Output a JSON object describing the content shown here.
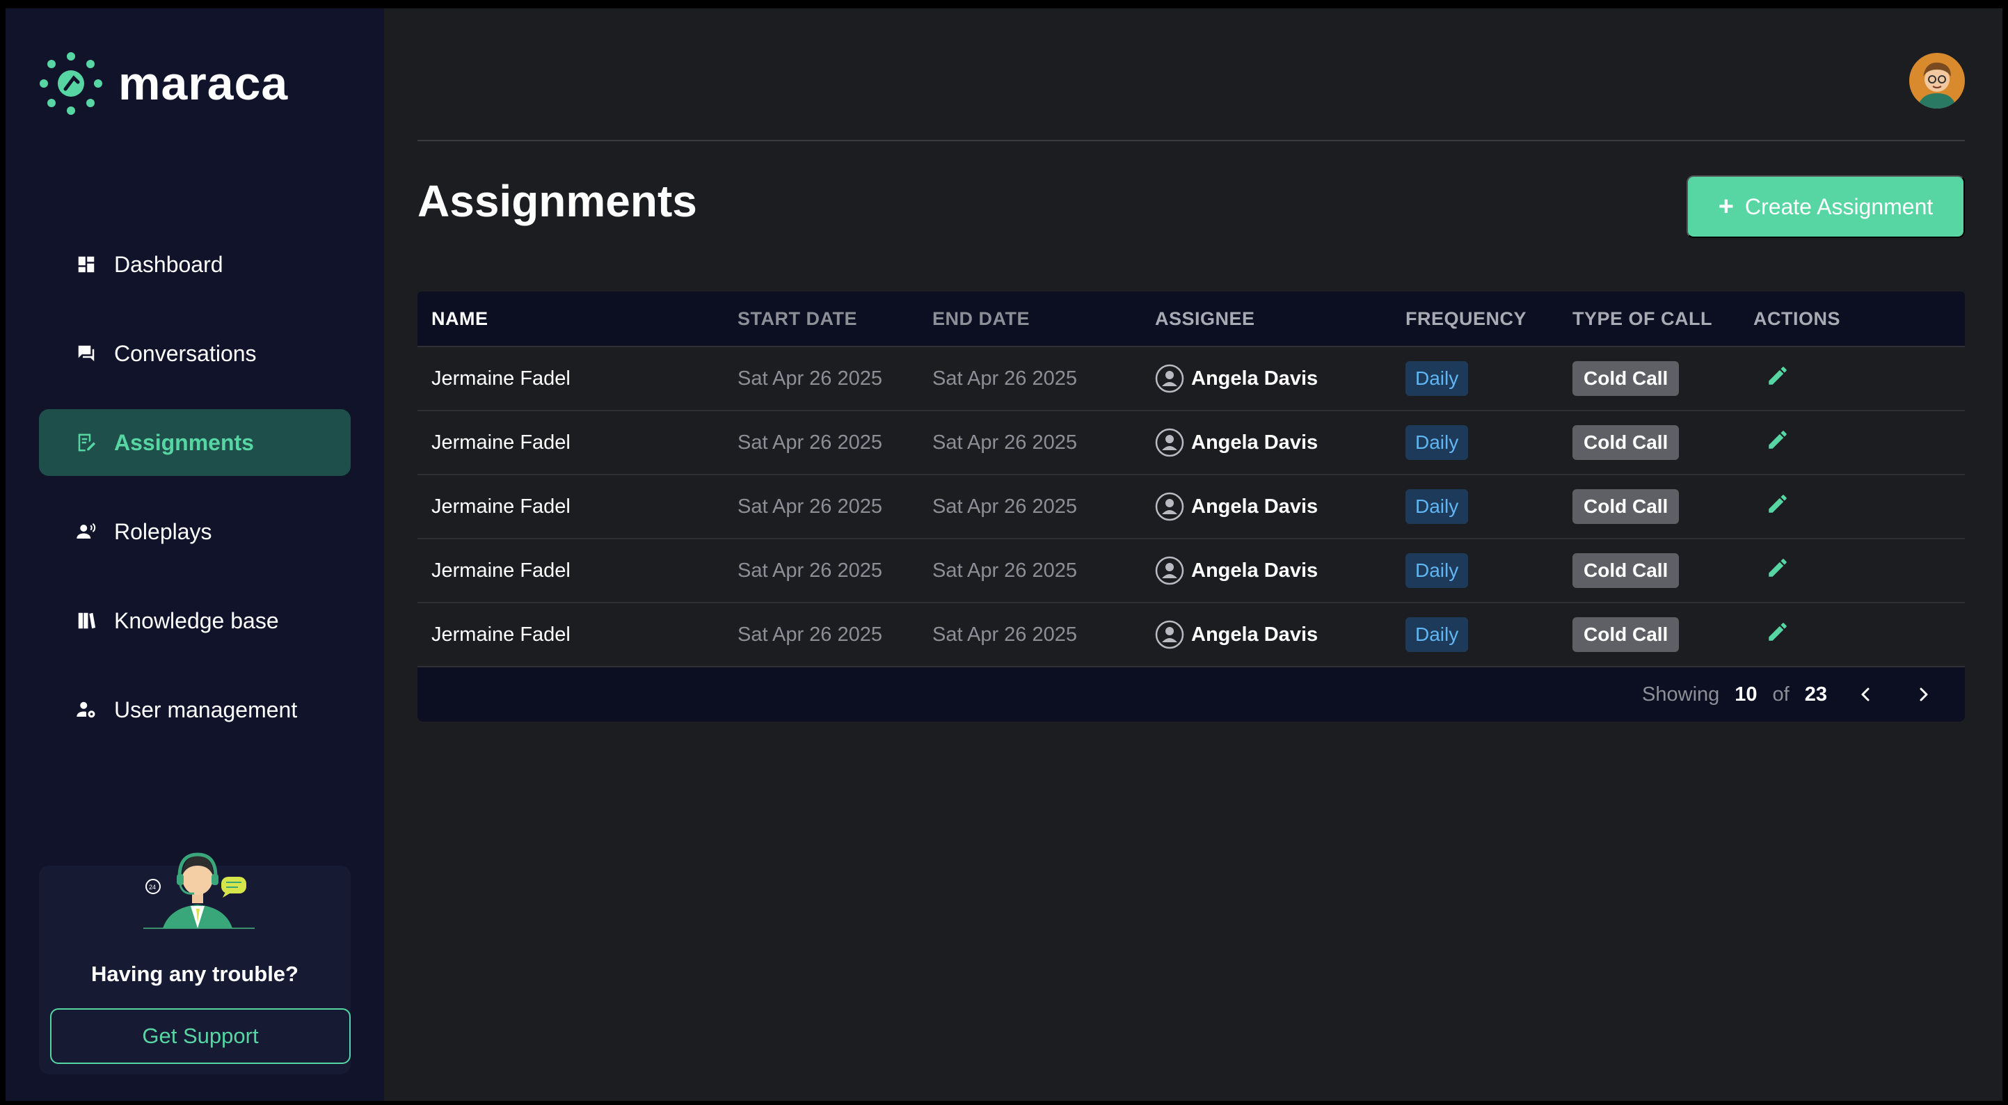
{
  "brand": {
    "name": "maraca",
    "accent": "#57d6a3"
  },
  "sidebar": {
    "items": [
      {
        "label": "Dashboard",
        "icon": "dashboard-icon",
        "active": false
      },
      {
        "label": "Conversations",
        "icon": "chat-icon",
        "active": false
      },
      {
        "label": "Assignments",
        "icon": "assignment-icon",
        "active": true
      },
      {
        "label": "Roleplays",
        "icon": "roleplay-icon",
        "active": false
      },
      {
        "label": "Knowledge base",
        "icon": "book-icon",
        "active": false
      },
      {
        "label": "User management",
        "icon": "user-settings-icon",
        "active": false
      }
    ],
    "support": {
      "title": "Having any trouble?",
      "button": "Get Support"
    }
  },
  "header": {
    "avatar": "user-avatar"
  },
  "main": {
    "title": "Assignments",
    "create_button": "Create Assignment",
    "table": {
      "columns": [
        "NAME",
        "START DATE",
        "END DATE",
        "ASSIGNEE",
        "FREQUENCY",
        "TYPE OF CALL",
        "ACTIONS"
      ],
      "rows": [
        {
          "name": "Jermaine Fadel",
          "start": "Sat Apr 26 2025",
          "end": "Sat Apr 26 2025",
          "assignee": "Angela Davis",
          "frequency": "Daily",
          "type": "Cold Call"
        },
        {
          "name": "Jermaine Fadel",
          "start": "Sat Apr 26 2025",
          "end": "Sat Apr 26 2025",
          "assignee": "Angela Davis",
          "frequency": "Daily",
          "type": "Cold Call"
        },
        {
          "name": "Jermaine Fadel",
          "start": "Sat Apr 26 2025",
          "end": "Sat Apr 26 2025",
          "assignee": "Angela Davis",
          "frequency": "Daily",
          "type": "Cold Call"
        },
        {
          "name": "Jermaine Fadel",
          "start": "Sat Apr 26 2025",
          "end": "Sat Apr 26 2025",
          "assignee": "Angela Davis",
          "frequency": "Daily",
          "type": "Cold Call"
        },
        {
          "name": "Jermaine Fadel",
          "start": "Sat Apr 26 2025",
          "end": "Sat Apr 26 2025",
          "assignee": "Angela Davis",
          "frequency": "Daily",
          "type": "Cold Call"
        }
      ]
    },
    "pagination": {
      "showing_label": "Showing",
      "showing": "10",
      "of_label": "of",
      "total": "23"
    }
  }
}
